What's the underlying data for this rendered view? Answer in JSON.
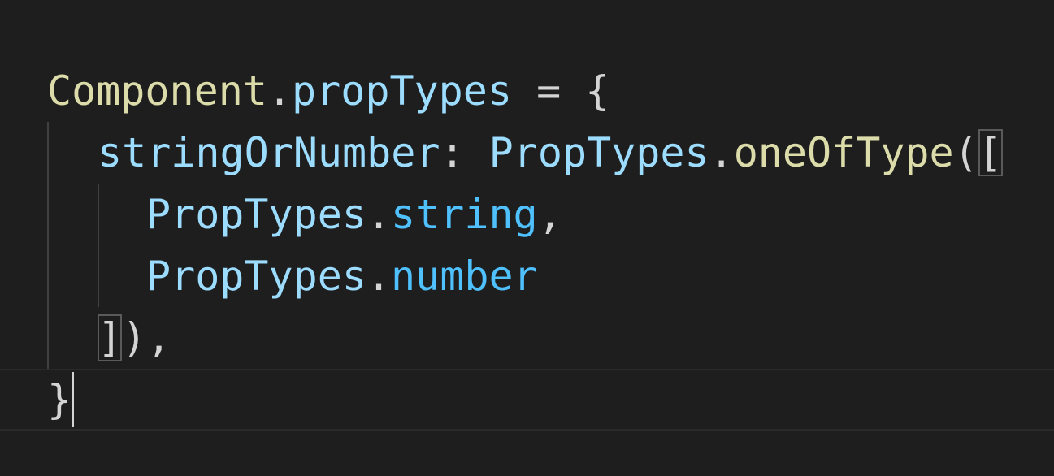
{
  "editor": {
    "lines": [
      {
        "object": "Component",
        "dot": ".",
        "property": "propTypes",
        "assign": " = ",
        "open_brace": "{"
      },
      {
        "key": "stringOrNumber",
        "colon": ": ",
        "cls": "PropTypes",
        "dot": ".",
        "method": "oneOfType",
        "open_paren": "(",
        "open_bracket": "["
      },
      {
        "cls": "PropTypes",
        "dot": ".",
        "member": "string",
        "comma": ","
      },
      {
        "cls": "PropTypes",
        "dot": ".",
        "member": "number"
      },
      {
        "close_bracket": "]",
        "close_paren": ")",
        "comma": ","
      },
      {
        "close_brace": "}"
      }
    ]
  },
  "colors": {
    "background": "#1e1e1e",
    "default_text": "#d4d4d4",
    "variable": "#dcdcaa",
    "property": "#9cdcfe",
    "member": "#4fc1ff"
  }
}
